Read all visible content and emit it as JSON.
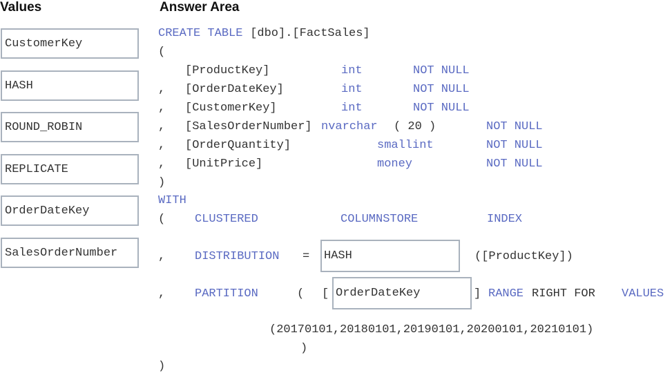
{
  "headings": {
    "values": "Values",
    "answer_area": "Answer Area"
  },
  "values": [
    "CustomerKey",
    "HASH",
    "ROUND_ROBIN",
    "REPLICATE",
    "OrderDateKey",
    "SalesOrderNumber"
  ],
  "code": {
    "create": "CREATE TABLE",
    "table_name": " [dbo].[FactSales]",
    "open_paren": "(",
    "close_paren": ")",
    "comma": ",",
    "columns": [
      {
        "name": "[ProductKey]",
        "type": "int",
        "null": "NOT NULL"
      },
      {
        "name": "[OrderDateKey]",
        "type": "int",
        "null": "NOT NULL"
      },
      {
        "name": "[CustomerKey]",
        "type": "int",
        "null": "NOT NULL"
      },
      {
        "name": "[SalesOrderNumber]",
        "type": "nvarchar",
        "type_arg": "( 20 )",
        "null": "NOT NULL"
      },
      {
        "name": "[OrderQuantity]",
        "type": "smallint",
        "null": "NOT NULL"
      },
      {
        "name": "[UnitPrice]",
        "type": "money",
        "null": "NOT NULL"
      }
    ],
    "with": "WITH",
    "clustered": "CLUSTERED",
    "columnstore": "COLUMNSTORE",
    "index": "INDEX",
    "distribution": "DISTRIBUTION",
    "equals": "=",
    "distribution_answer": "HASH",
    "distribution_column": "([ProductKey])",
    "partition": "PARTITION",
    "partition_open": "(",
    "bracket_open": "[",
    "partition_answer": "OrderDateKey",
    "bracket_close": "]",
    "range": "RANGE",
    "right_for": "RIGHT FOR",
    "values_kw": "VALUES",
    "range_values": "(20170101,20180101,20190101,20200101,20210101)",
    "partition_close": ")"
  }
}
